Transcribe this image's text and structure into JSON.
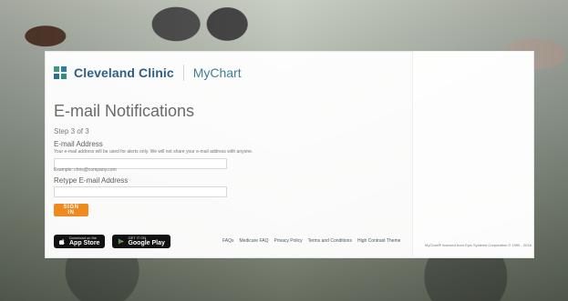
{
  "brand": {
    "name": "Cleveland Clinic",
    "product": "MyChart"
  },
  "page": {
    "title": "E-mail Notifications",
    "step": "Step 3 of 3"
  },
  "form": {
    "email_label": "E-mail Address",
    "email_help": "Your e-mail address will be used for alerts only. We will not share your e-mail address with anyone.",
    "email_value": "",
    "email_placeholder": "",
    "example_text": "Example: chris@company.com",
    "retype_label": "Retype E-mail Address",
    "retype_value": "",
    "retype_placeholder": ""
  },
  "actions": {
    "sign_in": "SIGN IN"
  },
  "badges": {
    "appstore_small": "Download on the",
    "appstore_big": "App Store",
    "googleplay_small": "GET IT ON",
    "googleplay_big": "Google Play"
  },
  "footer": {
    "links": [
      "FAQs",
      "Medicare FAQ",
      "Privacy Policy",
      "Terms and Conditions",
      "High Contrast Theme"
    ],
    "license": "MyChart® licensed from Epic Systems Corporation © 1999 - 2018"
  },
  "colors": {
    "accent": "#f08a1e",
    "brand_blue": "#2f5f86",
    "brand_teal": "#3f7f93"
  },
  "icons": {
    "brand_logo": "cleveland-clinic-logo-icon",
    "apple": "apple-icon",
    "google_play": "google-play-icon"
  }
}
